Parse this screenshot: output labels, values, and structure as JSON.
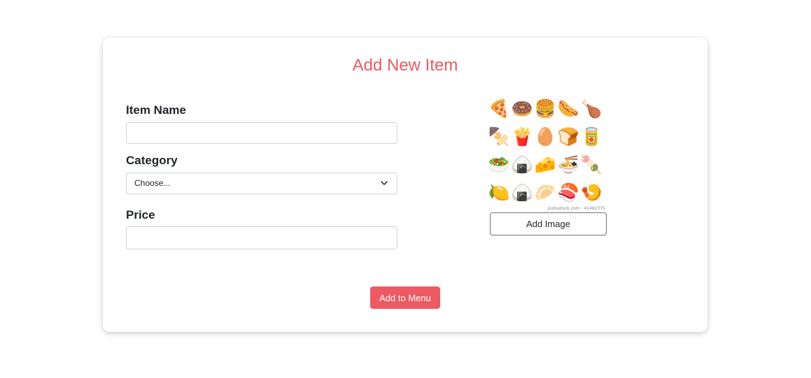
{
  "form": {
    "title": "Add New Item",
    "item_name_label": "Item Name",
    "item_name_value": "",
    "category_label": "Category",
    "category_selected": "Choose...",
    "price_label": "Price",
    "price_value": "",
    "add_image_label": "Add Image",
    "submit_label": "Add to Menu",
    "image_watermark": "pixtastock.com - 41482375"
  },
  "food_icons": [
    "🍕",
    "🍩",
    "🍔",
    "🌭",
    "🍗",
    "🍢",
    "🍟",
    "🥚",
    "🍞",
    "🥫",
    "🥗",
    "🍙",
    "🧀",
    "🍜",
    "🍡",
    "🍋",
    "🍙",
    "🥟",
    "🍣",
    "🍤"
  ],
  "colors": {
    "accent": "#f0545c",
    "title": "#ec5a62",
    "button_bg": "#ee5a63"
  },
  "icons": {
    "select_chevron": "chevron-down-icon",
    "food_image": "food-illustration-grid"
  }
}
